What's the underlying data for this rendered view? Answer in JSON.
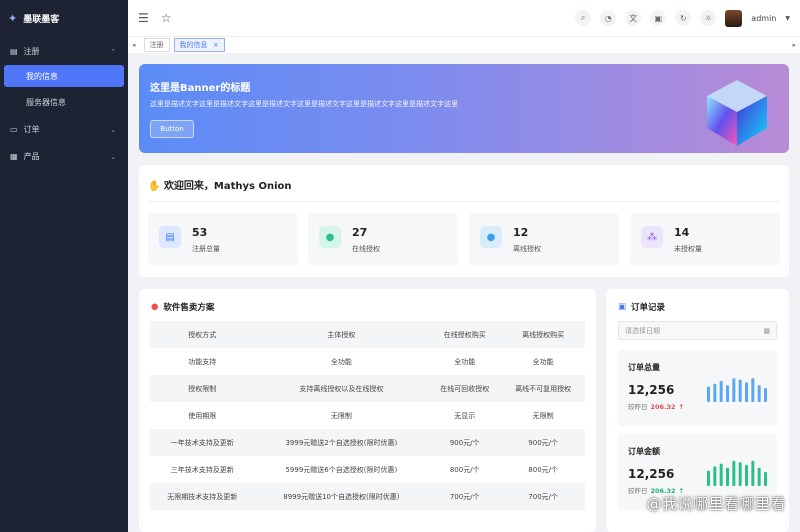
{
  "app": {
    "logo_text": "墨联墨客"
  },
  "sidebar": {
    "groups": [
      {
        "label": "注册",
        "icon": "server-icon",
        "expanded": true,
        "items": [
          {
            "label": "我的信息",
            "active": true
          },
          {
            "label": "服务器信息",
            "active": false
          }
        ]
      },
      {
        "label": "订单",
        "icon": "card-icon",
        "expanded": false
      },
      {
        "label": "产品",
        "icon": "grid-icon",
        "expanded": false
      }
    ]
  },
  "header": {
    "user_name": "admin"
  },
  "tabs": [
    {
      "label": "注册",
      "closable": false
    },
    {
      "label": "我的信息",
      "closable": true,
      "active": true
    }
  ],
  "banner": {
    "title": "这里是Banner的标题",
    "description": "这里是描述文字这里是描述文字这里是描述文字这里是描述文字这里是描述文字这里是描述文字这里",
    "button_label": "Button"
  },
  "welcome": {
    "greeting": "欢迎回来，Mathys Onion",
    "stats": [
      {
        "value": "53",
        "label": "注册总量",
        "icon": "register-icon",
        "color": "#3d7bf5",
        "bg": "#dbe8ff"
      },
      {
        "value": "27",
        "label": "在线授权",
        "icon": "user-online-icon",
        "color": "#2dbf8a",
        "bg": "#d6f5ea"
      },
      {
        "value": "12",
        "label": "离线授权",
        "icon": "user-offline-icon",
        "color": "#3aa0f0",
        "bg": "#d8ecfc"
      },
      {
        "value": "14",
        "label": "未授权量",
        "icon": "cluster-icon",
        "color": "#8a63e8",
        "bg": "#ece4fc"
      }
    ]
  },
  "sales": {
    "title": "软件售卖方案",
    "rows": [
      [
        "授权方式",
        "主体授权",
        "在线授权购买",
        "离线授权购买"
      ],
      [
        "功能支持",
        "全功能",
        "全功能",
        "全功能"
      ],
      [
        "授权限制",
        "支持离线授权以及在线授权",
        "在线可回收授权",
        "离线不可复用授权"
      ],
      [
        "使用期限",
        "无限制",
        "无显示",
        "无限制"
      ],
      [
        "一年技术支持及更新",
        "3999元赠送2个自选授权(限时优惠)",
        "900元/个",
        "900元/个"
      ],
      [
        "三年技术支持及更新",
        "5999元赠送6个自选授权(限时优惠)",
        "800元/个",
        "800元/个"
      ],
      [
        "无限期技术支持及更新",
        "8999元赠送10个自选授权(限时优惠)",
        "700元/个",
        "700元/个"
      ]
    ]
  },
  "orders": {
    "title": "订单记录",
    "date_placeholder": "请选择日期",
    "cards": [
      {
        "title": "订单总量",
        "value": "12,256",
        "compare_label": "较昨日",
        "delta": "206.32",
        "bar_color": "#5aa7f2",
        "bars": [
          0.55,
          0.65,
          0.75,
          0.6,
          0.85,
          0.8,
          0.7,
          0.85,
          0.6,
          0.5
        ]
      },
      {
        "title": "订单金额",
        "value": "12,256",
        "compare_label": "较昨日",
        "delta": "206.32",
        "bar_color": "#2dbf8a",
        "bars": [
          0.55,
          0.7,
          0.8,
          0.65,
          0.9,
          0.85,
          0.75,
          0.9,
          0.65,
          0.5
        ]
      }
    ]
  },
  "watermark": "@我说哪里看哪里看"
}
